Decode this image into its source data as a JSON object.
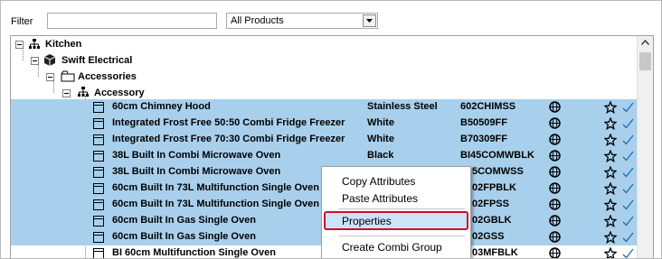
{
  "filter": {
    "label": "Filter",
    "value": ""
  },
  "product_select": {
    "value": "All Products"
  },
  "tree": {
    "kitchen": "Kitchen",
    "brand": "Swift Electrical",
    "accessories": "Accessories",
    "accessory": "Accessory"
  },
  "rows": [
    {
      "name": "60cm Chimney Hood",
      "colour": "Stainless Steel",
      "code": "602CHIMSS"
    },
    {
      "name": "Integrated Frost Free 50:50 Combi Fridge Freezer",
      "colour": "White",
      "code": "B50509FF"
    },
    {
      "name": "Integrated Frost Free 70:30 Combi Fridge Freezer",
      "colour": "White",
      "code": "B70309FF"
    },
    {
      "name": "38L Built In Combi Microwave Oven",
      "colour": "Black",
      "code": "BI45COMWBLK"
    },
    {
      "name": "38L Built In Combi Microwave Oven",
      "colour": "",
      "code": "5COMWSS"
    },
    {
      "name": "60cm Built In 73L Multifunction Single Oven",
      "colour": "",
      "code": "02FPBLK"
    },
    {
      "name": "60cm Built In 73L Multifunction Single Oven",
      "colour": "",
      "code": "02FPSS"
    },
    {
      "name": "60cm Built In Gas Single Oven",
      "colour": "",
      "code": "02GBLK"
    },
    {
      "name": "60cm Built In Gas Single Oven",
      "colour": "",
      "code": "02GSS"
    },
    {
      "name": "BI 60cm Multifunction Single Oven",
      "colour": "",
      "code": "03MFBLK"
    }
  ],
  "context_menu": {
    "copy": "Copy Attributes",
    "paste": "Paste Attributes",
    "properties": "Properties",
    "create_combi": "Create Combi Group"
  },
  "colors": {
    "selection": "#a8d0ec",
    "highlight_border": "#c8102e",
    "check": "#1a6fb0"
  }
}
